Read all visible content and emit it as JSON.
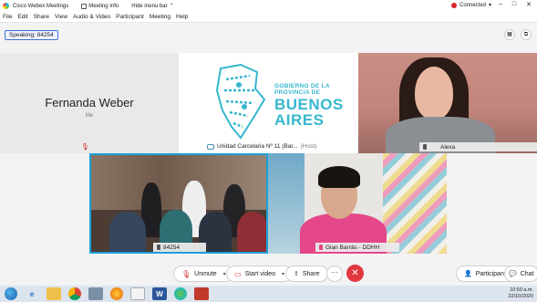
{
  "titlebar": {
    "app_name": "Cisco Webex Meetings",
    "meeting_info": "Meeting Info",
    "hide_menu_bar": "Hide menu bar",
    "status": "Connected",
    "controls": [
      "–",
      "□",
      "✕"
    ]
  },
  "menu": [
    "File",
    "Edit",
    "Share",
    "View",
    "Audio & Video",
    "Participant",
    "Meeting",
    "Help"
  ],
  "speaking": "Speaking: 84254",
  "tiles": {
    "me": {
      "name": "Fernanda Weber",
      "sub": "Me"
    },
    "host": {
      "logo_line1": "GOBIERNO DE LA",
      "logo_line2": "PROVINCIA DE",
      "logo_big1": "BUENOS",
      "logo_big2": "AIRES",
      "label": "Unidad Carcelaria Nº 11 (Bar...",
      "host_tag": "(Host)"
    },
    "alexa": {
      "name": "Alexa"
    },
    "room": {
      "name": "84254"
    },
    "gian": {
      "name": "Gian Barrás - DDHH"
    }
  },
  "controls": {
    "unmute": "Unmute",
    "start_video": "Start video",
    "share": "Share",
    "more": "···",
    "participants": "Participants",
    "chat": "Chat"
  },
  "taskbar": {
    "time": "10:50 a.m.",
    "date": "22/10/2020"
  },
  "colors": {
    "accent": "#1da0d8",
    "end_button": "#e0383e",
    "logo": "#37b7cf"
  }
}
